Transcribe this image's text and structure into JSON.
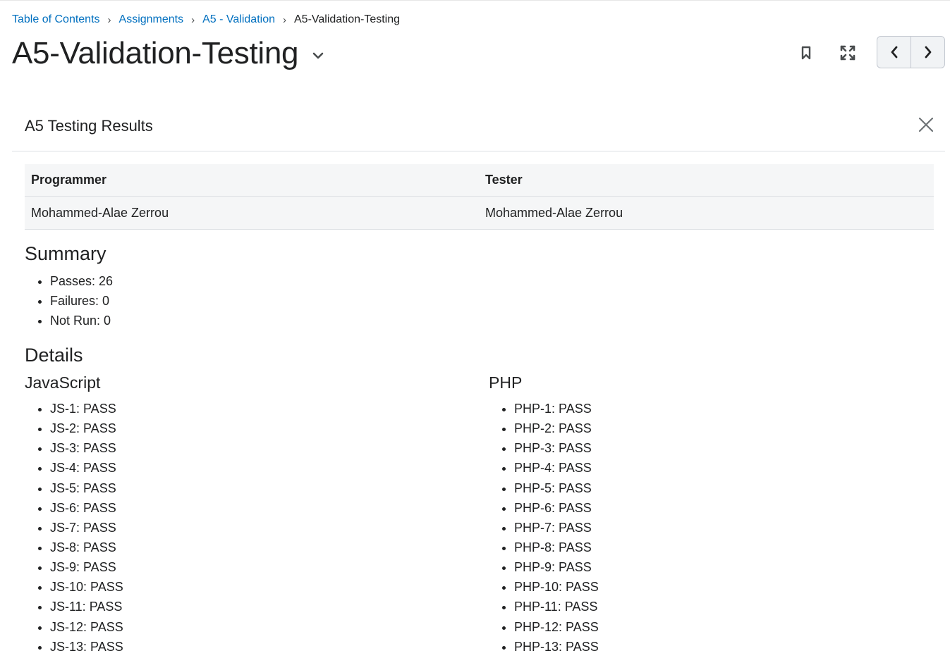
{
  "breadcrumb": {
    "links": [
      "Table of Contents",
      "Assignments",
      "A5 - Validation"
    ],
    "current": "A5-Validation-Testing",
    "separator": "›"
  },
  "page": {
    "title": "A5-Validation-Testing"
  },
  "toolbar": {
    "icons": [
      "bookmark-icon",
      "fullscreen-icon"
    ],
    "nav": [
      "previous-icon",
      "next-icon"
    ]
  },
  "panel": {
    "title": "A5 Testing Results"
  },
  "people_table": {
    "headers": [
      "Programmer",
      "Tester"
    ],
    "row": [
      "Mohammed-Alae Zerrou",
      "Mohammed-Alae Zerrou"
    ]
  },
  "summary": {
    "heading": "Summary",
    "items": [
      "Passes: 26",
      "Failures: 0",
      "Not Run: 0"
    ]
  },
  "details": {
    "heading": "Details",
    "javascript": {
      "heading": "JavaScript",
      "items": [
        "JS-1: PASS",
        "JS-2: PASS",
        "JS-3: PASS",
        "JS-4: PASS",
        "JS-5: PASS",
        "JS-6: PASS",
        "JS-7: PASS",
        "JS-8: PASS",
        "JS-9: PASS",
        "JS-10: PASS",
        "JS-11: PASS",
        "JS-12: PASS",
        "JS-13: PASS"
      ]
    },
    "php": {
      "heading": "PHP",
      "items": [
        "PHP-1: PASS",
        "PHP-2: PASS",
        "PHP-3: PASS",
        "PHP-4: PASS",
        "PHP-5: PASS",
        "PHP-6: PASS",
        "PHP-7: PASS",
        "PHP-8: PASS",
        "PHP-9: PASS",
        "PHP-10: PASS",
        "PHP-11: PASS",
        "PHP-12: PASS",
        "PHP-13: PASS"
      ]
    }
  },
  "colors": {
    "link": "#006fbf",
    "text": "#202122",
    "table_bg": "#f5f6f7",
    "border": "#dcdfe3"
  }
}
